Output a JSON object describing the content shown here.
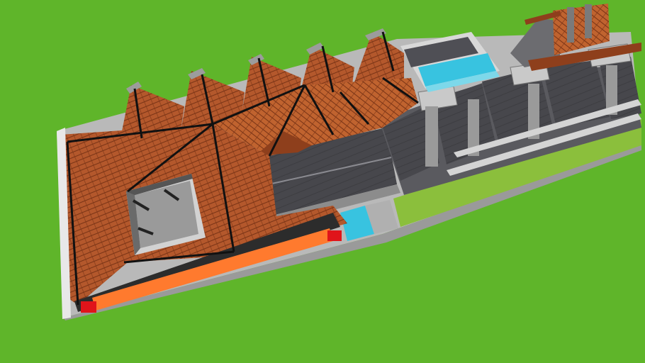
{
  "scene": {
    "kind": "3D architectural model render",
    "colors": {
      "grass": "#5fb52a",
      "roof_tile": "#b4582c",
      "roof_tile_dark": "#8e3f1c",
      "roof_ridge": "#111111",
      "dark_roof": "#4a4a4f",
      "wall_light": "#c9c9c9",
      "wall_dark": "#8c8c8c",
      "pool_water": "#38c3e0",
      "lawn_strip": "#8bbf3c",
      "orange_beam": "#ff7a2e",
      "red_block": "#e0141a"
    },
    "objects": [
      "terracotta-hip-roof-complex",
      "inner-courtyard",
      "dark-grey-roof-block",
      "rooftop-swimming-pool",
      "small-blue-pool",
      "chimney-tower-block",
      "utility-cube-row",
      "lawn-strip",
      "orange-eave-beam"
    ]
  }
}
